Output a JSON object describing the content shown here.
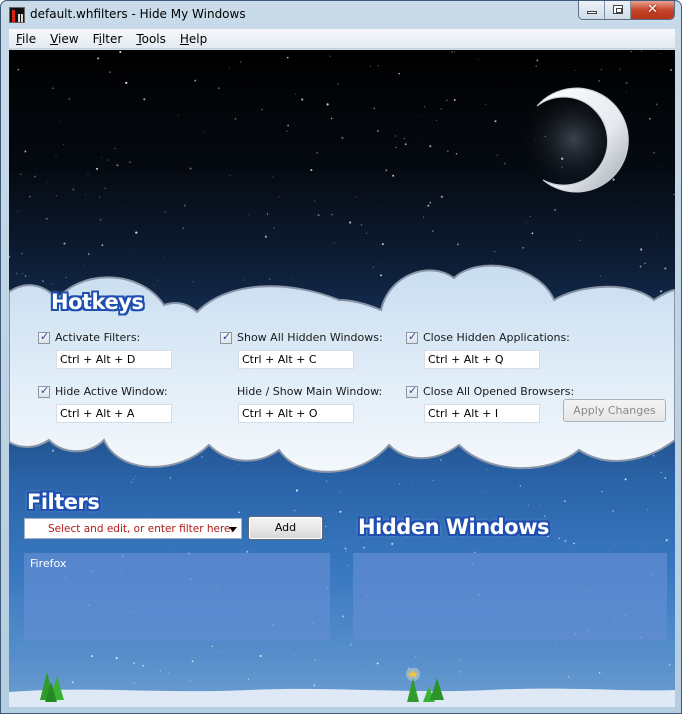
{
  "window": {
    "title": "default.whfilters - Hide My Windows",
    "app_icon": "hide-my-windows-app-icon",
    "caption_buttons": {
      "minimize": "minimize-icon",
      "maximize": "maximize-icon",
      "close": "close-icon",
      "close_glyph": "✕"
    }
  },
  "menubar": {
    "items": [
      {
        "label_accel": "F",
        "label_rest": "ile"
      },
      {
        "label_accel": "V",
        "label_rest": "iew"
      },
      {
        "label_pre": "F",
        "label_accel": "i",
        "label_rest": "lter"
      },
      {
        "label_accel": "T",
        "label_rest": "ools"
      },
      {
        "label_accel": "H",
        "label_rest": "elp"
      }
    ]
  },
  "hotkeys": {
    "heading": "Hotkeys",
    "items": [
      {
        "label": "Activate Filters:",
        "checked": true,
        "value": "Ctrl + Alt + D"
      },
      {
        "label": "Show All Hidden Windows:",
        "checked": true,
        "value": "Ctrl + Alt + C"
      },
      {
        "label": "Close Hidden Applications:",
        "checked": true,
        "value": "Ctrl + Alt + Q"
      },
      {
        "label": "Hide Active Window:",
        "checked": true,
        "value": "Ctrl + Alt + A"
      },
      {
        "label": "Hide / Show Main Window:",
        "checked": null,
        "value": "Ctrl + Alt + O"
      },
      {
        "label": "Close All Opened Browsers:",
        "checked": true,
        "value": "Ctrl + Alt + I"
      }
    ],
    "apply_button": "Apply Changes"
  },
  "filters": {
    "heading": "Filters",
    "combo_placeholder": "Select and edit, or enter filter here.",
    "add_button": "Add",
    "list": [
      "Firefox"
    ]
  },
  "hidden_windows": {
    "heading": "Hidden Windows",
    "list": []
  },
  "colors": {
    "heading_outline": "#1f4fb0",
    "placeholder_text": "#b01818",
    "list_bg": "#4a7fc4",
    "close_button": "#c7452a"
  }
}
